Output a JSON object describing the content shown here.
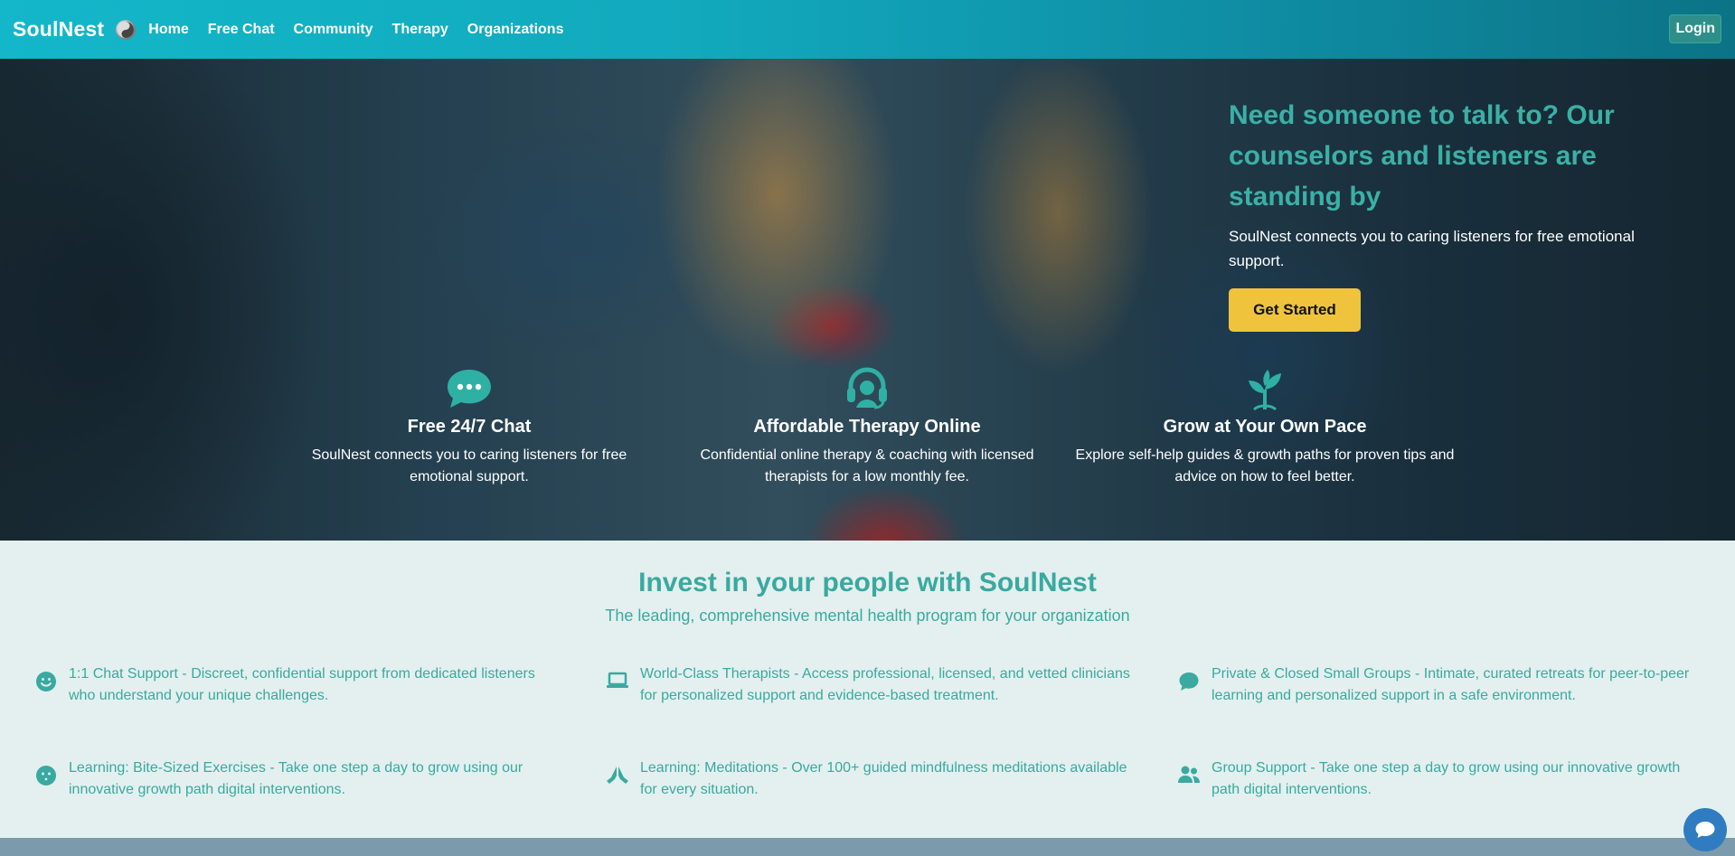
{
  "nav": {
    "brand": "SoulNest",
    "links": [
      "Home",
      "Free Chat",
      "Community",
      "Therapy",
      "Organizations"
    ],
    "login": "Login"
  },
  "hero": {
    "title": "Need someone to talk to? Our counselors and listeners are standing by",
    "subtitle": "SoulNest connects you to caring listeners for free emotional support.",
    "cta": "Get Started",
    "features": [
      {
        "icon": "chat-bubble-icon",
        "title": "Free 24/7 Chat",
        "text": "SoulNest connects you to caring listeners for free emotional support."
      },
      {
        "icon": "headset-icon",
        "title": "Affordable Therapy Online",
        "text": "Confidential online therapy & coaching with licensed therapists for a low monthly fee."
      },
      {
        "icon": "sprout-icon",
        "title": "Grow at Your Own Pace",
        "text": "Explore self-help guides & growth paths for proven tips and advice on how to feel better."
      }
    ]
  },
  "program": {
    "title": "Invest in your people with SoulNest",
    "subtitle": "The leading, comprehensive mental health program for your organization",
    "features": [
      {
        "icon": "smile-icon",
        "text": "1:1 Chat Support - Discreet, confidential support from dedicated listeners who understand your unique challenges."
      },
      {
        "icon": "laptop-icon",
        "text": "World-Class Therapists - Access professional, licensed, and vetted clinicians for personalized support and evidence-based treatment."
      },
      {
        "icon": "comment-icon",
        "text": "Private & Closed Small Groups - Intimate, curated retreats for peer-to-peer learning and personalized support in a safe environment."
      },
      {
        "icon": "face-icon",
        "text": "Learning: Bite-Sized Exercises - Take one step a day to grow using our innovative growth path digital interventions."
      },
      {
        "icon": "praying-hands-icon",
        "text": "Learning: Meditations - Over 100+ guided mindfulness meditations available for every situation."
      },
      {
        "icon": "users-icon",
        "text": "Group Support - Take one step a day to grow using our innovative growth path digital interventions."
      }
    ]
  },
  "colors": {
    "accent": "#3aa99f",
    "cta": "#f0c33c",
    "nav": "#13b7c9"
  }
}
